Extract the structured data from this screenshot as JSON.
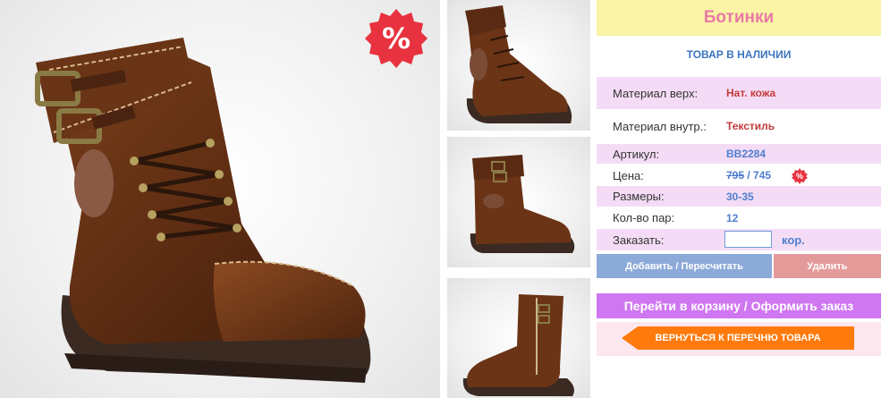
{
  "product": {
    "title": "Ботинки",
    "stock_status": "ТОВАР В НАЛИЧИИ",
    "sale_badge": "%"
  },
  "specs": {
    "material_top_label": "Материал верх:",
    "material_top_value": "Нат. кожа",
    "material_inner_label": "Материал внутр.:",
    "material_inner_value": "Текстиль",
    "article_label": "Артикул:",
    "article_value": "BB2284",
    "price_label": "Цена:",
    "price_old": "795",
    "price_separator": " / ",
    "price_new": "745",
    "price_badge": "%",
    "sizes_label": "Размеры:",
    "sizes_value": "30-35",
    "pairs_label": "Кол-во пар:",
    "pairs_value": "12",
    "order_label": "Заказать:",
    "order_qty": "",
    "order_unit": "кор."
  },
  "actions": {
    "add_label": "Добавить / Пересчитать",
    "delete_label": "Удалить",
    "cart_label": "Перейти в корзину / Оформить заказ",
    "back_label": "ВЕРНУТЬСЯ К ПЕРЕЧНЮ ТОВАРА"
  },
  "colors": {
    "title_bg": "#fbf3a6",
    "title_text": "#e97ba6",
    "row_pink": "#f5dcf6",
    "link_blue": "#3a74be",
    "cart_purple": "#cf77f1",
    "back_orange": "#ff7a0c",
    "boot_brown": "#6b3416"
  },
  "icons": {
    "sale": "sale-badge-icon",
    "thumbs": [
      "boot-front-thumb",
      "boot-side-thumb",
      "boot-zip-thumb"
    ]
  }
}
